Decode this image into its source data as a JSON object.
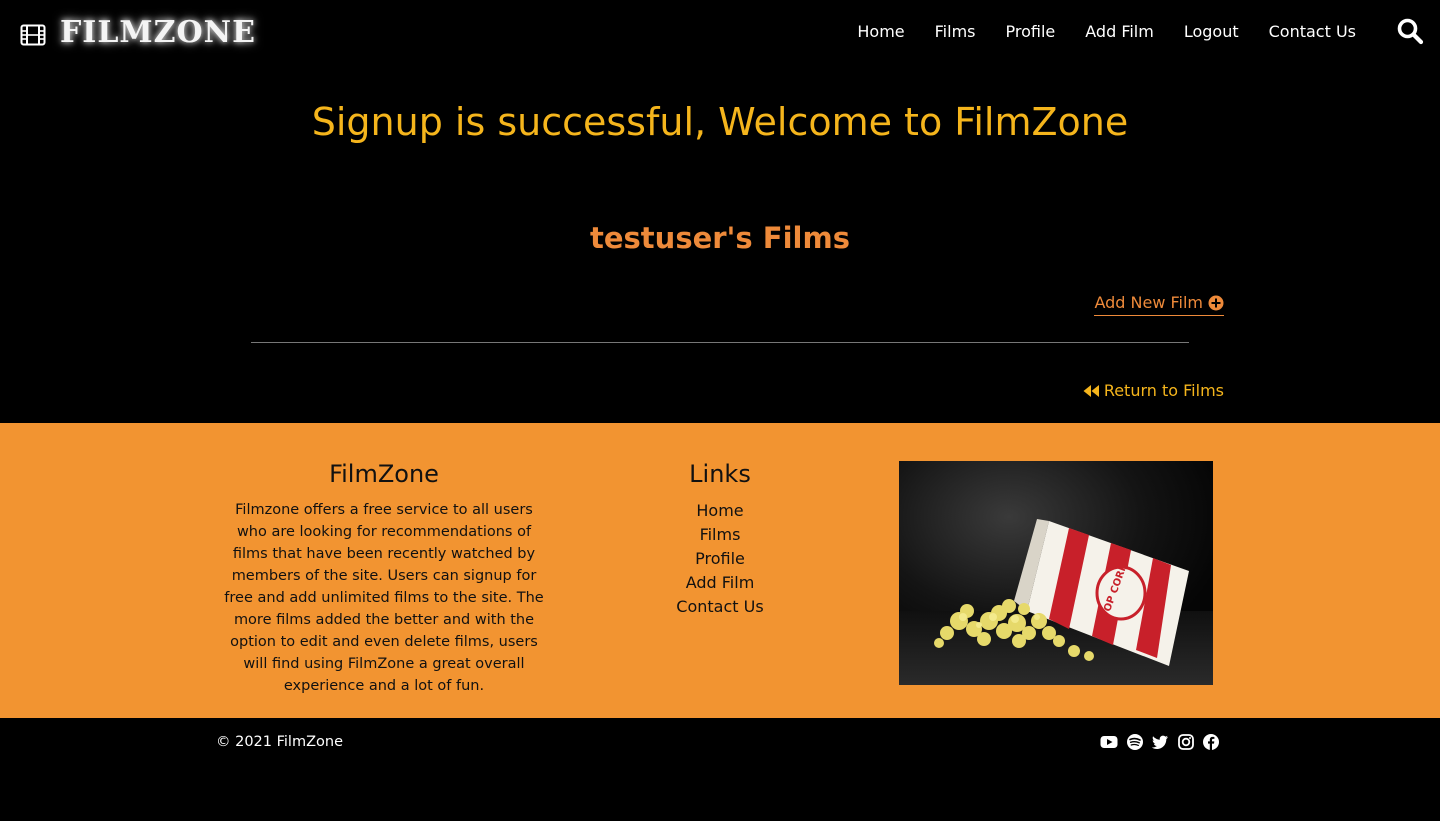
{
  "nav": {
    "brand": "FILMZONE",
    "links": [
      "Home",
      "Films",
      "Profile",
      "Add Film",
      "Logout",
      "Contact Us"
    ]
  },
  "main": {
    "welcome": "Signup is successful, Welcome to FilmZone",
    "films_heading": "testuser's Films",
    "add_new_film": "Add New Film",
    "return_to_films": "Return to Films"
  },
  "footer": {
    "about_title": "FilmZone",
    "about_text": "Filmzone offers a free service to all users who are looking for recommendations of films that have been recently watched by members of the site. Users can signup for free and add unlimited films to the site. The more films added the better and with the option to edit and even delete films, users will find using FilmZone a great overall experience and a lot of fun.",
    "links_title": "Links",
    "links": [
      "Home",
      "Films",
      "Profile",
      "Add Film",
      "Contact Us"
    ],
    "image_text": "POP CORN",
    "copyright": "© 2021 FilmZone",
    "socials": [
      "youtube-icon",
      "spotify-icon",
      "twitter-icon",
      "instagram-icon",
      "facebook-icon"
    ]
  },
  "colors": {
    "welcome": "#f5b51c",
    "films_heading": "#ee8a3a",
    "footer_bg": "#f29431",
    "page_bg": "#000000"
  }
}
